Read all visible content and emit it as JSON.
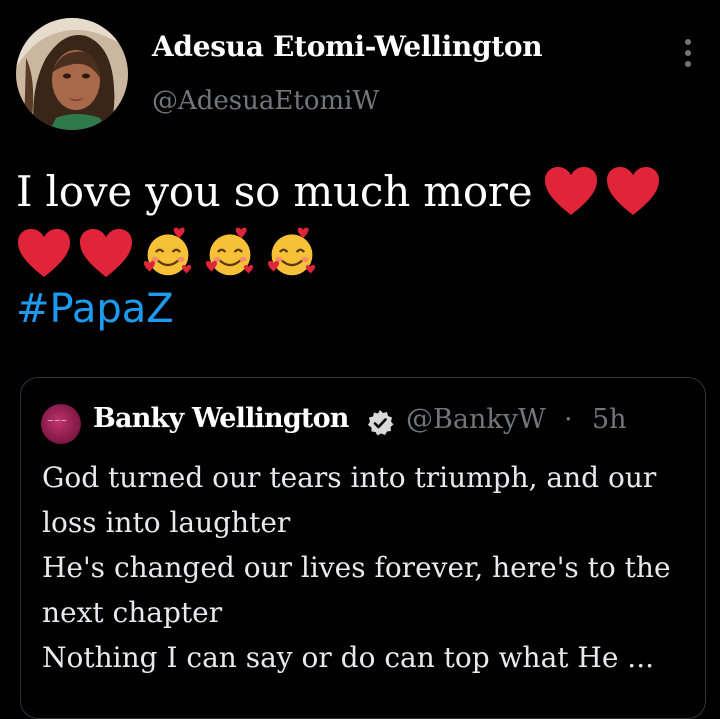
{
  "tweet": {
    "author": {
      "display_name": "Adesua Etomi-Wellington",
      "handle": "@AdesuaEtomiW"
    },
    "text": "I love you so much more",
    "emojis_row1": [
      "red-heart",
      "red-heart"
    ],
    "emojis_row2": [
      "red-heart",
      "red-heart",
      "smiling-face-with-hearts",
      "smiling-face-with-hearts",
      "smiling-face-with-hearts"
    ],
    "hashtag": "#PapaZ"
  },
  "quoted_tweet": {
    "author": {
      "display_name": "Banky Wellington",
      "verified": true,
      "handle": "@BankyW",
      "separator": "·",
      "time": "5h"
    },
    "lines": [
      "God turned our tears into triumph, and our",
      "loss into laughter",
      "He's changed our lives forever, here's to the",
      "next chapter",
      "Nothing I can say or do can top what He ..."
    ]
  },
  "colors": {
    "background": "#000000",
    "text": "#ffffff",
    "muted": "#71767b",
    "link": "#1d9bf0",
    "border": "#2f3336",
    "heart": "#e0243a",
    "verified_badge": "#d9d9d9"
  },
  "icons": {
    "more": "more-vertical-icon",
    "verified": "verified-badge-icon"
  }
}
